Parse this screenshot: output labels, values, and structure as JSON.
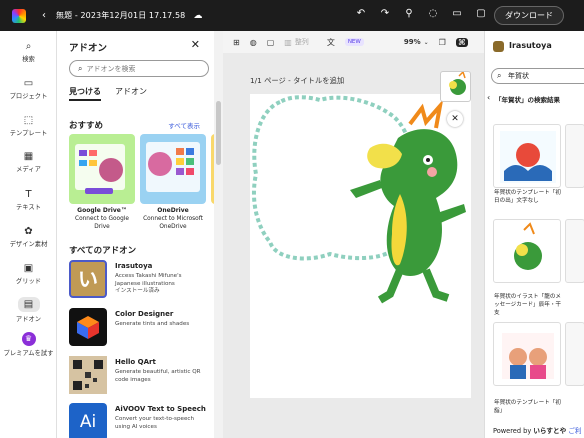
{
  "app": {
    "title": "無題 - 2023年12月01日 17.17.58",
    "download": "ダウンロード"
  },
  "rail": [
    {
      "label": "検索",
      "icon": "⌕"
    },
    {
      "label": "プロジェクト",
      "icon": "▭"
    },
    {
      "label": "テンプレート",
      "icon": "⬚"
    },
    {
      "label": "メディア",
      "icon": "▦"
    },
    {
      "label": "テキスト",
      "icon": "T"
    },
    {
      "label": "デザイン素材",
      "icon": "✿"
    },
    {
      "label": "グリッド",
      "icon": "▣"
    },
    {
      "label": "アドオン",
      "icon": "▤"
    },
    {
      "label": "プレミアムを試す",
      "icon": "♛"
    }
  ],
  "panel": {
    "title": "アドオン",
    "search_placeholder": "アドオンを検索",
    "tabs": [
      "見つける",
      "アドオン"
    ],
    "recommend": "おすすめ",
    "see_all": "すべて表示",
    "cards": [
      {
        "name": "Google Drive™",
        "desc": "Connect to Google Drive"
      },
      {
        "name": "OneDrive",
        "desc": "Connect to Microsoft OneDrive"
      }
    ],
    "all_addons": "すべてのアドオン",
    "addons": [
      {
        "name": "Irasutoya",
        "desc": "Access Takashi Mifune's Japanese illustrations",
        "extra": "インストール済み"
      },
      {
        "name": "Color Designer",
        "desc": "Generate tints and shades"
      },
      {
        "name": "Hello QArt",
        "desc": "Generate beautiful, artistic QR code images"
      },
      {
        "name": "AiVOOV Text to Speech",
        "desc": "Convert your text-to-speech using AI voices"
      }
    ]
  },
  "toolbar": {
    "layout": "整列",
    "new_badge": "NEW",
    "zoom": "99%"
  },
  "canvas": {
    "page_label": "1/1 ページ - タイトルを追加"
  },
  "right_panel": {
    "title": "Irasutoya",
    "search_value": "年賀状",
    "heading": "「年賀状」の検索結果",
    "items": [
      {
        "caption": "年賀状のテンプレート「初日の出」文字なし"
      },
      {
        "caption": "年賀状のイラスト「龍のメッセージカード」辰年・干支"
      },
      {
        "caption": "年賀状のテンプレート「初詣」"
      }
    ],
    "powered_by": "Powered by",
    "brand": "いらすとや",
    "link": "ご利"
  }
}
